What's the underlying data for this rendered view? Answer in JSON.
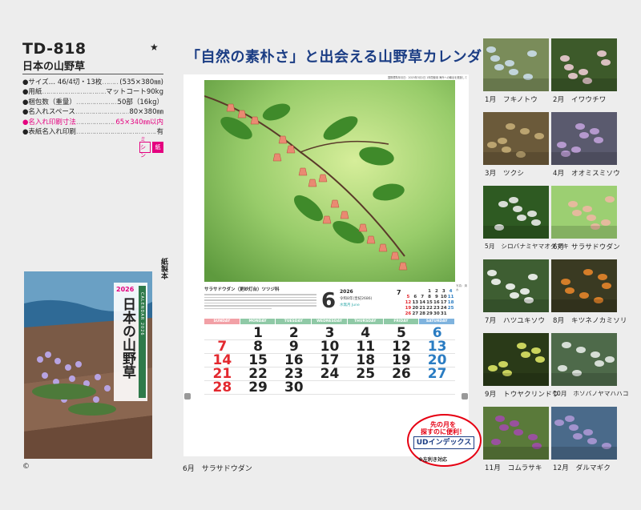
{
  "product": {
    "code": "TD-818",
    "name": "日本の山野草",
    "star": "★"
  },
  "specs": [
    {
      "key": "●サイズ… 46/4切・13枚",
      "value": "(535×380㎜)",
      "pink": false
    },
    {
      "key": "●用紙",
      "value": "マットコート90kg",
      "pink": false
    },
    {
      "key": "●梱包数（重量）",
      "value": "50部（16kg）",
      "pink": false
    },
    {
      "key": "●名入れスペース",
      "value": "80×380㎜",
      "pink": false
    },
    {
      "key": "●名入れ印刷寸法",
      "value": "65×340㎜以内",
      "pink": true
    },
    {
      "key": "●表紙名入れ印刷",
      "value": "有",
      "pink": false
    }
  ],
  "badges": [
    "ミシン",
    "紙"
  ],
  "cover": {
    "year": "2026",
    "title": "日本の山野草",
    "band": "CALENDAR 2026",
    "side_label": "紙製本"
  },
  "copyright": "©",
  "headline": "「自然の素朴さ」と出会える山野草カレンダー",
  "calendar": {
    "credit_line": "国際標準年月日：2025年3月1日  1年間使用  海外への輸出を推奨して",
    "photo_credit": "写真：清水",
    "caption_title": "サラサドウダン（更紗灯台）ツツジ科",
    "month": "6",
    "year": "2026",
    "era": "令和8年(皇紀2686)",
    "month_name": "水無月 June",
    "weekdays": [
      "SUNDAY",
      "MONDAY",
      "TUESDAY",
      "WEDNESDAY",
      "THURSDAY",
      "FRIDAY",
      "SATURDAY"
    ],
    "weekday_colors": [
      "#f2a0a6",
      "#8fc9a6",
      "#8fc9a6",
      "#8fc9a6",
      "#8fc9a6",
      "#8fc9a6",
      "#7fb3de"
    ],
    "weeks": [
      [
        "",
        "1",
        "2",
        "3",
        "4",
        "5",
        "6"
      ],
      [
        "7",
        "8",
        "9",
        "10",
        "11",
        "12",
        "13"
      ],
      [
        "14",
        "15",
        "16",
        "17",
        "18",
        "19",
        "20"
      ],
      [
        "21",
        "22",
        "23",
        "24",
        "25",
        "26",
        "27"
      ],
      [
        "28",
        "29",
        "30",
        "",
        "",
        "",
        ""
      ]
    ],
    "prev_month_label": "7",
    "mini_prev": [
      [
        "",
        "",
        "",
        "1",
        "2",
        "3",
        "4"
      ],
      [
        "5",
        "6",
        "7",
        "8",
        "9",
        "10",
        "11"
      ],
      [
        "12",
        "13",
        "14",
        "15",
        "16",
        "17",
        "18"
      ],
      [
        "19",
        "20",
        "21",
        "22",
        "23",
        "24",
        "25"
      ],
      [
        "26",
        "27",
        "28",
        "29",
        "30",
        "31",
        ""
      ]
    ],
    "bottom_caption": "6月　サラサドウダン"
  },
  "ud_badge": {
    "top_line1": "先の月を",
    "top_line2": "探すのに便利！",
    "main": "UDインデックス",
    "note": "※左利き対応"
  },
  "thumbnails": [
    {
      "label": "1月　フキノトウ",
      "bg": "#7a8c5a",
      "accent": "#cfe2f2"
    },
    {
      "label": "2月　イワウチワ",
      "bg": "#3d5a2a",
      "accent": "#f6d2dc"
    },
    {
      "label": "3月　ツクシ",
      "bg": "#6b5a3a",
      "accent": "#c9b27a"
    },
    {
      "label": "4月　オオミスミソウ",
      "bg": "#5a5a6e",
      "accent": "#c6a4df"
    },
    {
      "label": "5月　シロバナミヤマオダマキ",
      "bg": "#2e5a22",
      "accent": "#f4f4f4"
    },
    {
      "label": "6月　サラサドウダン",
      "bg": "#9ccf72",
      "accent": "#f2b6a4"
    },
    {
      "label": "7月　ハツユキソウ",
      "bg": "#3e5e32",
      "accent": "#ffffff"
    },
    {
      "label": "8月　キツネノカミソリ",
      "bg": "#3a3a22",
      "accent": "#f08a2a"
    },
    {
      "label": "9月　トウヤクリンドウ",
      "bg": "#2a3a18",
      "accent": "#e8f06a"
    },
    {
      "label": "10月　ホソバノヤマハハコ",
      "bg": "#4e6a4a",
      "accent": "#eef2ee"
    },
    {
      "label": "11月　コムラサキ",
      "bg": "#5a7a3a",
      "accent": "#a54ab0"
    },
    {
      "label": "12月　ダルマギク",
      "bg": "#4a6a8a",
      "accent": "#b29ad8"
    }
  ]
}
